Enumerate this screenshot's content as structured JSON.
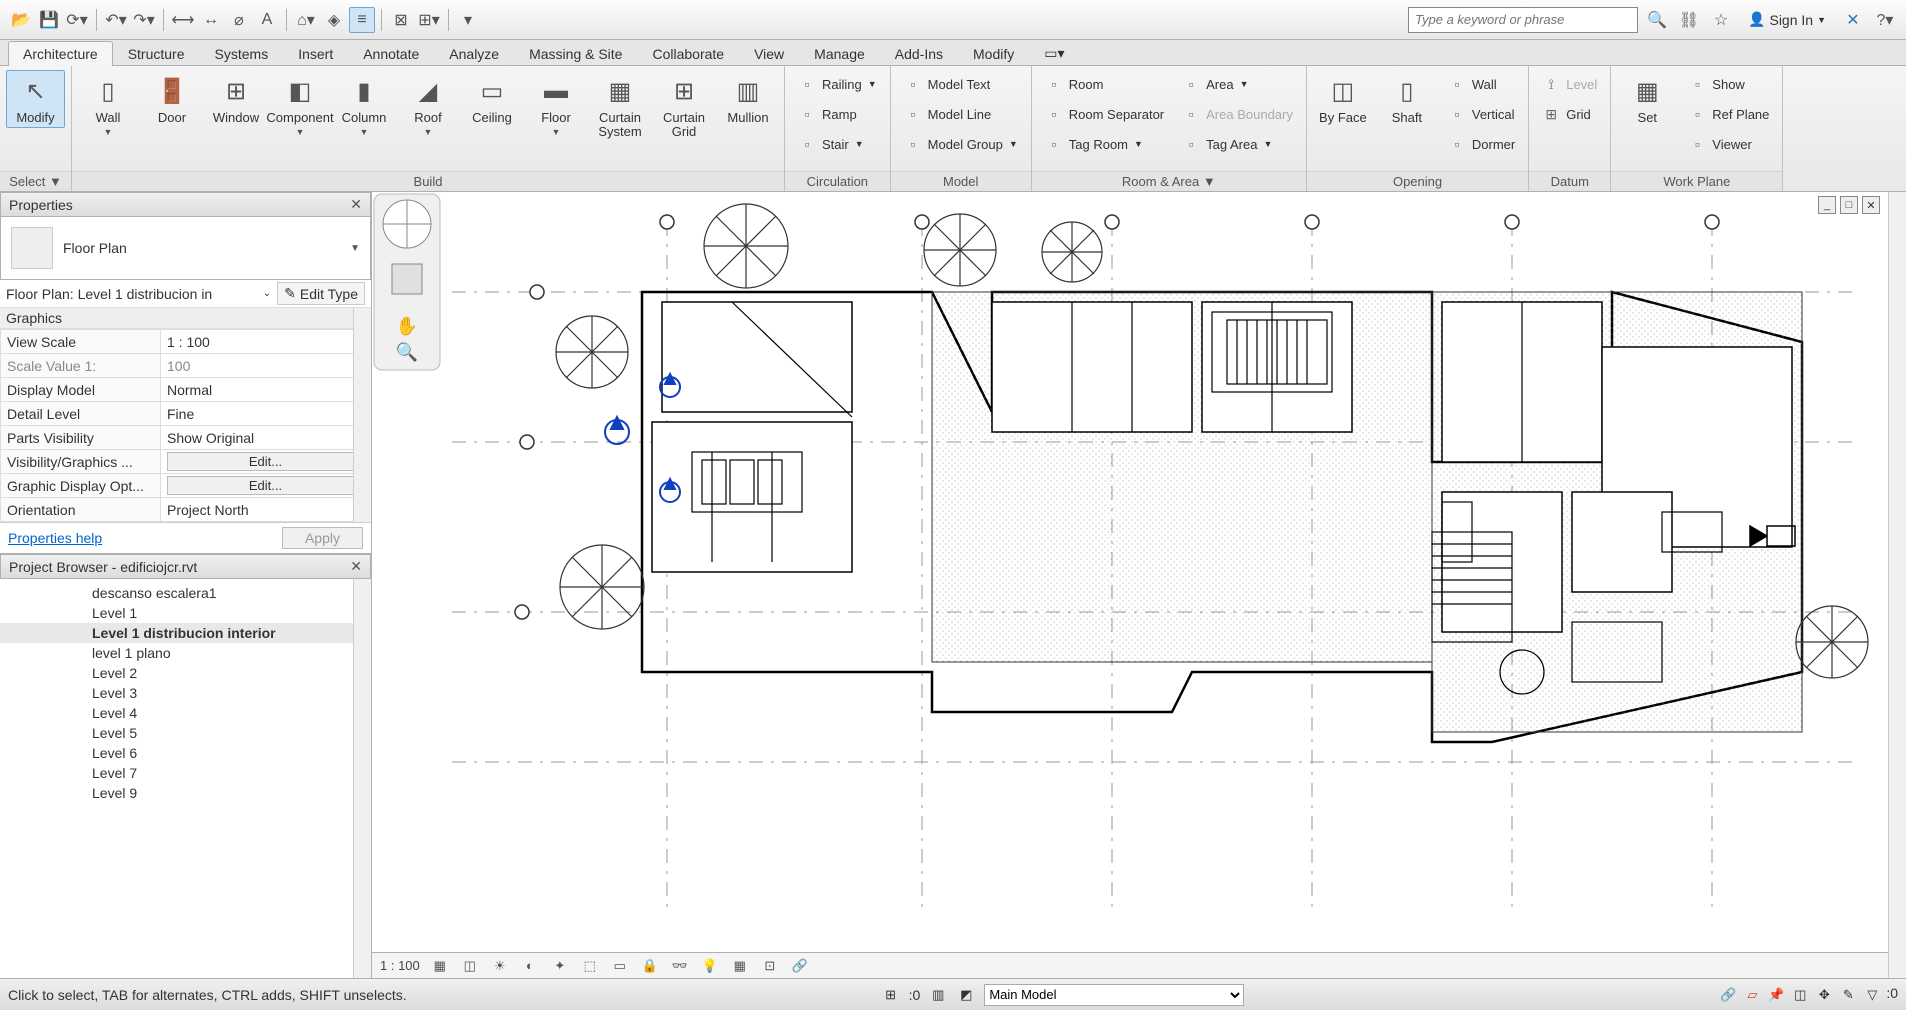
{
  "qat": {
    "search_placeholder": "Type a keyword or phrase",
    "signin": "Sign In"
  },
  "tabs": [
    "Architecture",
    "Structure",
    "Systems",
    "Insert",
    "Annotate",
    "Analyze",
    "Massing & Site",
    "Collaborate",
    "View",
    "Manage",
    "Add-Ins",
    "Modify"
  ],
  "active_tab": 0,
  "ribbon": {
    "select": {
      "modify": "Modify",
      "title": "Select"
    },
    "build": {
      "title": "Build",
      "items": [
        "Wall",
        "Door",
        "Window",
        "Component",
        "Column",
        "Roof",
        "Ceiling",
        "Floor",
        "Curtain System",
        "Curtain Grid",
        "Mullion"
      ]
    },
    "circulation": {
      "title": "Circulation",
      "items": [
        "Railing",
        "Ramp",
        "Stair"
      ]
    },
    "model": {
      "title": "Model",
      "items": [
        "Model Text",
        "Model Line",
        "Model Group"
      ]
    },
    "room_area": {
      "title": "Room & Area",
      "col1": [
        "Room",
        "Room Separator",
        "Tag Room"
      ],
      "col2": [
        "Area",
        "Area Boundary",
        "Tag Area"
      ]
    },
    "opening": {
      "title": "Opening",
      "by_face": "By Face",
      "shaft": "Shaft",
      "items": [
        "Wall",
        "Vertical",
        "Dormer"
      ]
    },
    "datum": {
      "title": "Datum",
      "level": "Level",
      "grid": "Grid"
    },
    "workplane": {
      "title": "Work Plane",
      "set": "Set",
      "items": [
        "Show",
        "Ref Plane",
        "Viewer"
      ]
    }
  },
  "properties": {
    "title": "Properties",
    "type_name": "Floor Plan",
    "instance": "Floor Plan: Level 1 distribucion in",
    "edit_type": "Edit Type",
    "category": "Graphics",
    "rows": [
      {
        "k": "View Scale",
        "v": "1 : 100"
      },
      {
        "k": "Scale Value    1:",
        "v": "100",
        "gray": true
      },
      {
        "k": "Display Model",
        "v": "Normal"
      },
      {
        "k": "Detail Level",
        "v": "Fine"
      },
      {
        "k": "Parts Visibility",
        "v": "Show Original"
      },
      {
        "k": "Visibility/Graphics ...",
        "v": "Edit...",
        "btn": true
      },
      {
        "k": "Graphic Display Opt...",
        "v": "Edit...",
        "btn": true
      },
      {
        "k": "Orientation",
        "v": "Project North"
      }
    ],
    "help": "Properties help",
    "apply": "Apply"
  },
  "browser": {
    "title": "Project Browser - edificiojcr.rvt",
    "items": [
      "descanso escalera1",
      "Level 1",
      "Level 1 distribucion interior",
      "level 1 plano",
      "Level 2",
      "Level 3",
      "Level 4",
      "Level 5",
      "Level 6",
      "Level 7",
      "Level 9"
    ],
    "selected_index": 2
  },
  "viewcontrol": {
    "scale": "1 : 100"
  },
  "status": {
    "msg": "Click to select, TAB for alternates, CTRL adds, SHIFT unselects.",
    "zero": ":0",
    "workset": "Main Model",
    "filter": ":0"
  }
}
